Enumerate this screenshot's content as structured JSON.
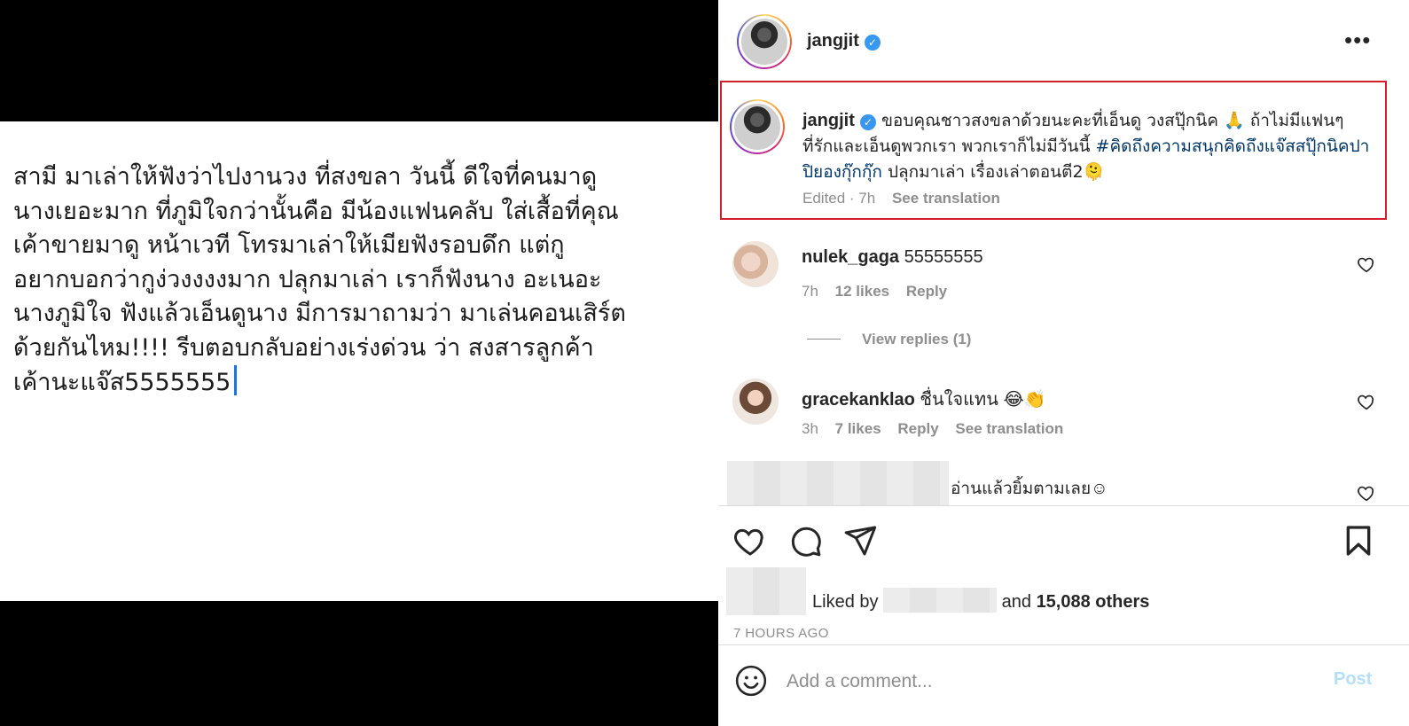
{
  "image_post": {
    "text": "สามี มาเล่าให้ฟังว่าไปงานวง ที่สงขลา วันนี้ ดีใจที่คนมาดู\nนางเยอะมาก ที่ภูมิใจกว่านั้นคือ มีน้องแฟนคลับ ใส่เสื้อที่คุณ\nเค้าขายมาดู หน้าเวที โทรมาเล่าให้เมียฟังรอบดึก แต่กู\nอยากบอกว่ากูง่วงงงงมาก ปลุกมาเล่า เราก็ฟังนาง อะเนอะ\nนางภูมิใจ ฟังแล้วเอ็นดูนาง มีการมาถามว่า มาเล่นคอนเสิร์ต\nด้วยกันไหม!!!! รีบตอบกลับอย่างเร่งด่วน ว่า สงสารลูกค้า\nเค้านะแจ๊ส5555555"
  },
  "header": {
    "username": "jangjit",
    "verified_icon": "verified-badge-icon",
    "more_icon": "more-options-icon",
    "more_glyph": "•••"
  },
  "caption": {
    "username": "jangjit",
    "text": "ขอบคุณชาวสงขลาด้วยนะคะที่เอ็นดู วงสปุ๊กนิค 🙏  ถ้าไม่มีแฟนๆที่รักและเอ็นดูพวกเรา พวกเราก็ไม่มีวันนี้ ",
    "hashtag": "#คิดถึงความสนุกคิดถึงแจ๊สสปุ๊กนิคปาปิยองกุ๊กกุ๊ก",
    "text_after": " ปลุกมาเล่า เรื่องเล่าตอนตี2🫠",
    "edited": "Edited · 7h",
    "see_translation": "See translation"
  },
  "comments": [
    {
      "username": "nulek_gaga",
      "text": "55555555",
      "time": "7h",
      "likes": "12 likes",
      "reply": "Reply",
      "view_replies": "View replies (1)"
    },
    {
      "username": "gracekanklao",
      "text": "ชื่นใจแทน 😂👏",
      "time": "3h",
      "likes": "7 likes",
      "reply": "Reply",
      "see_translation": "See translation"
    },
    {
      "text": "อ่านแล้วยิ้มตามเลย☺"
    }
  ],
  "actions": {
    "like_icon": "heart-icon",
    "comment_icon": "comment-icon",
    "share_icon": "share-icon",
    "save_icon": "bookmark-icon"
  },
  "likes": {
    "prefix": "Liked by",
    "and": "and",
    "count": "15,088 others"
  },
  "time_ago": "7 HOURS AGO",
  "comment_box": {
    "placeholder": "Add a comment...",
    "post_label": "Post",
    "emoji_icon": "emoji-icon"
  },
  "colors": {
    "highlight_border": "#d21f2b",
    "verified": "#3897f0",
    "hashtag": "#00376b",
    "post_button": "#b2dffc"
  }
}
